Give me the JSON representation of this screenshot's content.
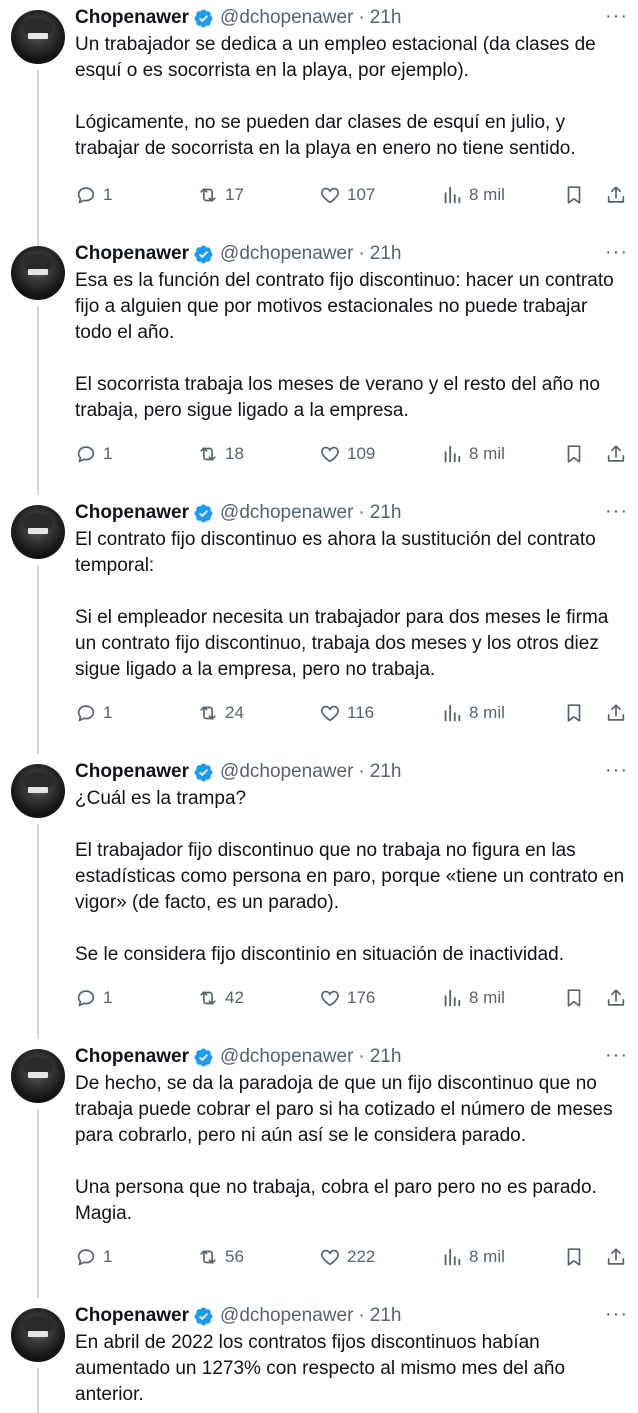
{
  "tweets": [
    {
      "name": "Chopenawer",
      "handle": "@dchopenawer",
      "time": "21h",
      "paragraphs": [
        "Un trabajador se dedica a un empleo estacional (da clases de esquí o es socorrista en la playa, por ejemplo).",
        "Lógicamente, no se pueden dar clases de esquí en julio, y trabajar de socorrista en la playa en enero no tiene sentido."
      ],
      "replies": "1",
      "retweets": "17",
      "likes": "107",
      "views": "8 mil"
    },
    {
      "name": "Chopenawer",
      "handle": "@dchopenawer",
      "time": "21h",
      "paragraphs": [
        "Esa es la función del contrato fijo discontinuo: hacer un contrato fijo a alguien que por motivos estacionales no puede trabajar todo el año.",
        "El socorrista trabaja los meses de verano y el resto del año no trabaja, pero sigue ligado a la empresa."
      ],
      "replies": "1",
      "retweets": "18",
      "likes": "109",
      "views": "8 mil"
    },
    {
      "name": "Chopenawer",
      "handle": "@dchopenawer",
      "time": "21h",
      "paragraphs": [
        "El contrato fijo discontinuo es ahora la sustitución del contrato temporal:",
        "Si el empleador necesita un trabajador para dos meses le firma un contrato fijo discontinuo, trabaja dos meses y los otros diez sigue ligado a la empresa, pero no trabaja."
      ],
      "replies": "1",
      "retweets": "24",
      "likes": "116",
      "views": "8 mil"
    },
    {
      "name": "Chopenawer",
      "handle": "@dchopenawer",
      "time": "21h",
      "paragraphs": [
        "¿Cuál es la trampa?",
        "El trabajador fijo discontinuo que no trabaja no figura en las estadísticas como persona en paro, porque «tiene un contrato en vigor» (de facto, es un parado).",
        "Se le considera fijo discontinio en situación de inactividad."
      ],
      "replies": "1",
      "retweets": "42",
      "likes": "176",
      "views": "8 mil"
    },
    {
      "name": "Chopenawer",
      "handle": "@dchopenawer",
      "time": "21h",
      "paragraphs": [
        "De hecho, se da la paradoja de que un fijo discontinuo que no trabaja puede cobrar el paro si ha cotizado el número de meses para cobrarlo, pero ni aún así se le considera parado.",
        "Una persona que no trabaja, cobra el paro pero no es parado. Magia."
      ],
      "replies": "1",
      "retweets": "56",
      "likes": "222",
      "views": "8 mil"
    },
    {
      "name": "Chopenawer",
      "handle": "@dchopenawer",
      "time": "21h",
      "paragraphs": [
        "En abril de 2022 los contratos fijos discontinuos habían aumentado un 1273% con respecto al mismo mes del año anterior."
      ]
    }
  ],
  "separator": "·",
  "more_glyph": "···",
  "colors": {
    "text": "#0f1419",
    "muted": "#536471",
    "verified": "#1d9bf0",
    "thread_line": "#cfd9de"
  }
}
